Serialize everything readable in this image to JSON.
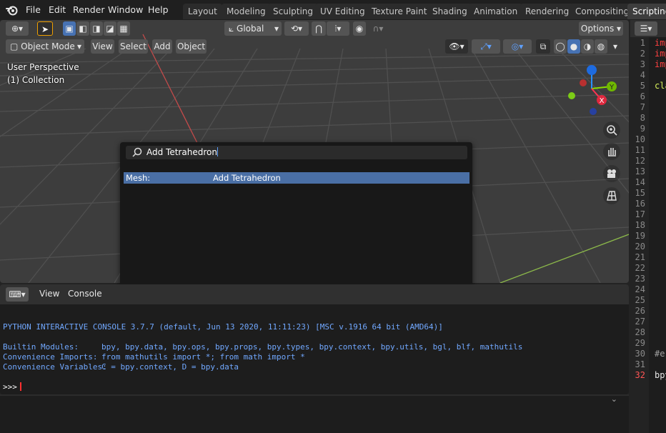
{
  "topbar": {
    "menus": [
      "File",
      "Edit",
      "Render",
      "Window",
      "Help"
    ],
    "workspaces": [
      "Layout",
      "Modeling",
      "Sculpting",
      "UV Editing",
      "Texture Paint",
      "Shading",
      "Animation",
      "Rendering",
      "Compositing",
      "Scripting"
    ],
    "active_workspace": "Scripting"
  },
  "viewport": {
    "transform_orientation": "Global",
    "options_label": "Options",
    "mode": "Object Mode",
    "menus": [
      "View",
      "Select",
      "Add",
      "Object"
    ],
    "perspective": "User Perspective",
    "collection": "(1) Collection",
    "gizmo_axes": [
      "X",
      "Y",
      "Z"
    ]
  },
  "search_popup": {
    "query": "Add Tetrahedron",
    "result_category": "Mesh:",
    "result_label": "Add Tetrahedron"
  },
  "console": {
    "menus": [
      "View",
      "Console"
    ],
    "header_line": "PYTHON INTERACTIVE CONSOLE 3.7.7 (default, Jun 13 2020, 11:11:23) [MSC v.1916 64 bit (AMD64)]",
    "builtin_label": "Builtin Modules:",
    "builtin_value": "bpy, bpy.data, bpy.ops, bpy.props, bpy.types, bpy.context, bpy.utils, bgl, blf, mathutils",
    "imports_label": "Convenience Imports:",
    "imports_value": "from mathutils import *; from math import *",
    "vars_label": "Convenience Variables:",
    "vars_value": "C = bpy.context, D = bpy.data",
    "prompt": ">>>"
  },
  "text_editor": {
    "line_numbers": [
      "1",
      "2",
      "3",
      "4",
      "5",
      "6",
      "7",
      "8",
      "9",
      "10",
      "11",
      "12",
      "13",
      "14",
      "15",
      "16",
      "17",
      "18",
      "19",
      "20",
      "21",
      "22",
      "23",
      "24",
      "25",
      "26",
      "27",
      "28",
      "29",
      "30",
      "31",
      "32"
    ],
    "current_line": "32",
    "code_fragments": {
      "l1": "imp",
      "l2": "imp",
      "l3": "imp",
      "l5": "cla",
      "l30": "#er",
      "l32": "bpy"
    }
  },
  "colors": {
    "accent": "#4772b3",
    "selection": "#4a6fa5",
    "x_axis": "#ff3352",
    "y_axis": "#8bdc00",
    "z_axis": "#2890ff",
    "console_text": "#71a8ff"
  }
}
